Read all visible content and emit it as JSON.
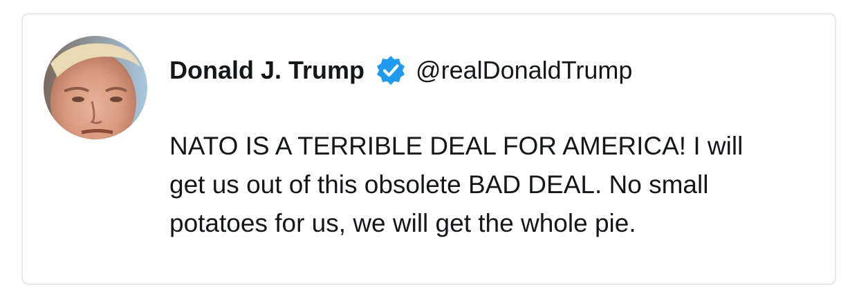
{
  "tweet": {
    "author": {
      "display_name": "Donald J. Trump",
      "handle": "@realDonaldTrump",
      "verified": true
    },
    "text": "NATO IS A TERRIBLE DEAL FOR AMERICA! I will\nget us out of this obsolete BAD DEAL. No small\npotatoes for us, we will get the whole pie."
  },
  "icons": {
    "avatar": "profile-photo",
    "verified": "verified-badge-icon"
  },
  "colors": {
    "verified_blue": "#1d9bf0",
    "text": "#14171a",
    "border": "#e6e8eb"
  }
}
